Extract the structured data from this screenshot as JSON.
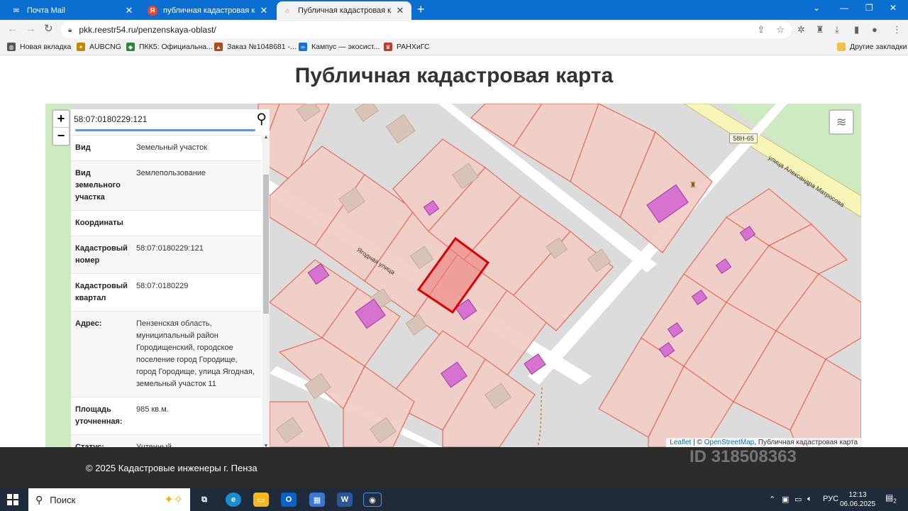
{
  "browser": {
    "tabs": [
      {
        "title": "Почта Mail",
        "icon": "mail-icon",
        "active": false
      },
      {
        "title": "публичная кадастровая карта п",
        "icon": "yandex-icon",
        "active": false
      },
      {
        "title": "Публичная кадастровая карта П",
        "icon": "home-icon",
        "active": true
      }
    ],
    "url": "pkk.reestr54.ru/penzenskaya-oblast/",
    "bookmarks": [
      {
        "label": "Новая вкладка",
        "icon": "globe-icon",
        "color": "#555555"
      },
      {
        "label": "AUBCNG",
        "icon": "emblem-icon",
        "color": "#c08a00"
      },
      {
        "label": "ПКК5: Официальна...",
        "icon": "pkk-icon",
        "color": "#2a8a3a"
      },
      {
        "label": "Заказ №1048681 -...",
        "icon": "order-icon",
        "color": "#b04a1a"
      },
      {
        "label": "Кампус — экосист...",
        "icon": "campus-icon",
        "color": "#1a6fd0"
      },
      {
        "label": "РАНХиГС",
        "icon": "ranepa-icon",
        "color": "#c0392b"
      }
    ],
    "other_bookmarks": "Другие закладки"
  },
  "page": {
    "title": "Публичная кадастровая карта",
    "footer": "© 2025 Кадастровые инженеры г. Пенза",
    "watermark": "ID 318508363"
  },
  "map": {
    "search_value": "58:07:0180229:121",
    "zoom_in": "+",
    "zoom_out": "−",
    "street_label": "Ягодная улица",
    "street_label2": "улица Александра Матросова",
    "road_shield": "58Н-65",
    "attribution_leaflet": "Leaflet",
    "attribution_sep": " | © ",
    "attribution_osm": "OpenStreetMap",
    "attribution_pkk": ", Публичная кадастровая карта"
  },
  "info": {
    "rows": [
      {
        "key": "Вид",
        "value": "Земельный участок"
      },
      {
        "key": "Вид земельного участка",
        "value": "Землепользование"
      },
      {
        "key": "Координаты",
        "value": ""
      },
      {
        "key": "Кадастровый номер",
        "value": "58:07:0180229:121"
      },
      {
        "key": "Кадастровый квартал",
        "value": "58:07:0180229"
      },
      {
        "key": "Адрес:",
        "value": "Пензенская область, муниципальный район Городищенский, городское поселение город Городище, город Городище, улица Ягодная, земельный участок 11"
      },
      {
        "key": "Площадь уточненная:",
        "value": "985 кв.м."
      },
      {
        "key": "Статус:",
        "value": "Учтенный"
      }
    ]
  },
  "taskbar": {
    "search_placeholder": "Поиск",
    "language": "РУС",
    "time": "12:13",
    "date": "06.06.2025",
    "notifications": "2"
  }
}
